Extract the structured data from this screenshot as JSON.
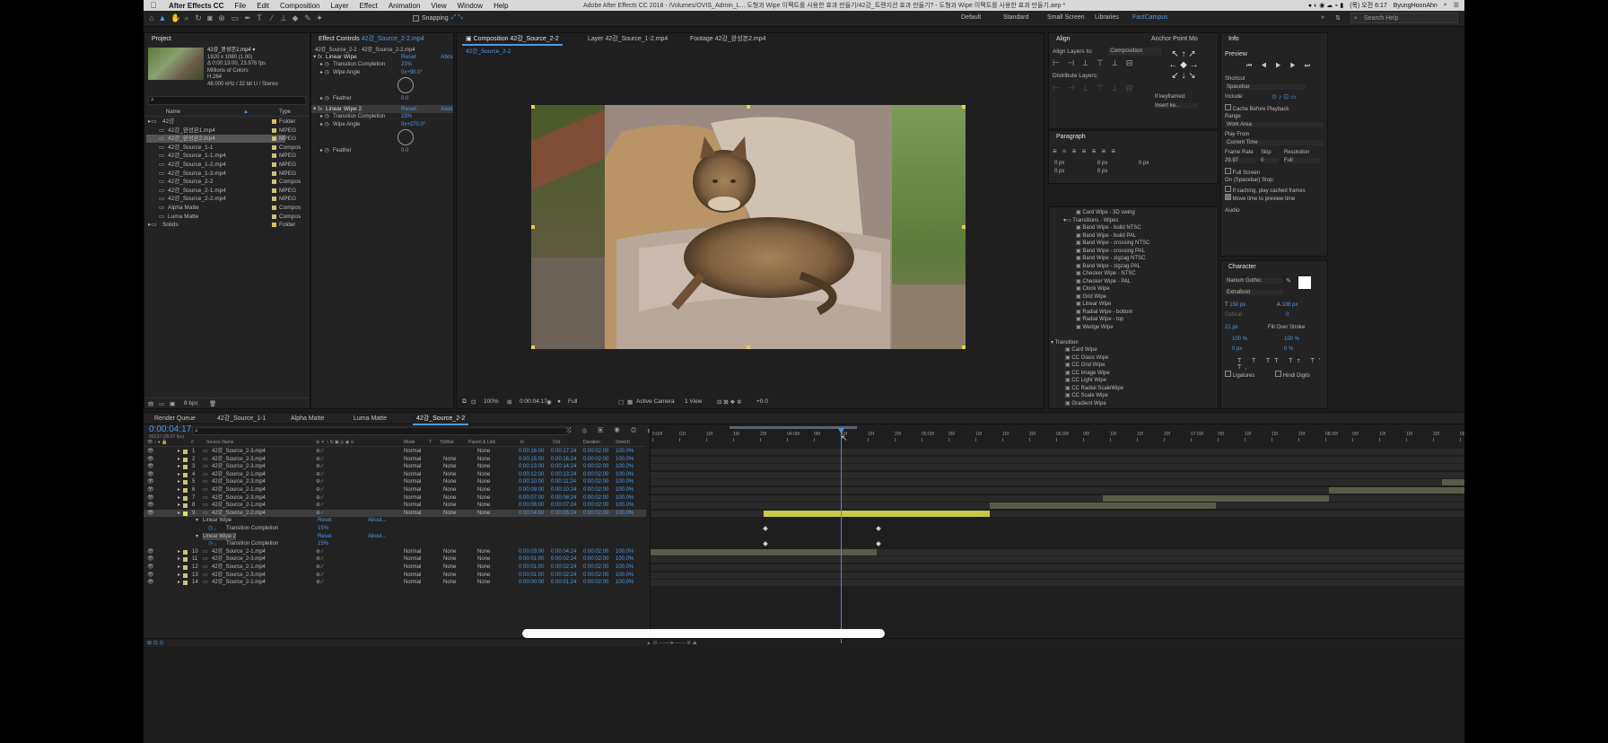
{
  "menubar": {
    "app_name": "After Effects CC",
    "items": [
      "File",
      "Edit",
      "Composition",
      "Layer",
      "Effect",
      "Animation",
      "View",
      "Window",
      "Help"
    ],
    "window_title": "Adobe After Effects CC 2018 - /Volumes/OVIS_Admin_L... 도형과 Wipe 이펙트를 사용한 효과 만들기/42강_트랜지션 효과 만들기? - 도형과 Wipe 이펙트를 사용한 효과 만들기.aep *",
    "clock": "(목) 오전 6:17",
    "user": "ByungHoonAhn"
  },
  "toolbar": {
    "snapping_label": "Snapping",
    "workspaces": [
      "Default",
      "Standard",
      "Small Screen",
      "Libraries",
      "FastCampus"
    ],
    "active_workspace": "FastCampus",
    "search_placeholder": "Search Help"
  },
  "project": {
    "tab": "Project",
    "selected_name": "42강_완성본2.mp4 ▾",
    "info_lines": [
      "1920 x 1080 (1.00)",
      "Δ 0:00:13:00, 23.976 fps",
      "Millions of Colors",
      "H.264",
      "48.000 kHz / 32 bit U / Stereo"
    ],
    "columns": {
      "name": "Name",
      "type": "Type"
    },
    "items": [
      {
        "name": "42강",
        "type": "Folder",
        "color": "#e0c050",
        "folder": true
      },
      {
        "name": "42강_완성본1.mp4",
        "type": "MPEG",
        "color": "#c9c37a"
      },
      {
        "name": "42강_완성본2.mp4",
        "type": "MPEG",
        "color": "#c9c37a",
        "selected": true
      },
      {
        "name": "42강_Source_1-1",
        "type": "Compos",
        "color": "#c9c37a"
      },
      {
        "name": "42강_Source_1-1.mp4",
        "type": "MPEG",
        "color": "#c9c37a"
      },
      {
        "name": "42강_Source_1-2.mp4",
        "type": "MPEG",
        "color": "#c9c37a"
      },
      {
        "name": "42강_Source_1-3.mp4",
        "type": "MPEG",
        "color": "#c9c37a"
      },
      {
        "name": "42강_Source_2-2",
        "type": "Compos",
        "color": "#c9c37a"
      },
      {
        "name": "42강_Source_2-1.mp4",
        "type": "MPEG",
        "color": "#c9c37a"
      },
      {
        "name": "42강_Source_2-2.mp4",
        "type": "MPEG",
        "color": "#c9c37a"
      },
      {
        "name": "Alpha Matte",
        "type": "Compos",
        "color": "#c9c37a"
      },
      {
        "name": "Luma Matte",
        "type": "Compos",
        "color": "#c9c37a"
      },
      {
        "name": "Solids",
        "type": "Folder",
        "color": "#e0c050",
        "folder": true
      }
    ],
    "bpc": "8 bpc"
  },
  "effect_controls": {
    "tab_prefix": "Effect Controls",
    "tab_target": "42강_Source_2-2.mp4",
    "breadcrumb": "42강_Source_2-2 · 42강_Source_2-2.mp4",
    "effects": [
      {
        "name": "Linear Wipe",
        "reset": "Reset",
        "about": "About...",
        "props": [
          {
            "label": "Transition Completion",
            "value": "23%"
          },
          {
            "label": "Wipe Angle",
            "value": "0x+90.0°"
          },
          {
            "label": "Feather",
            "value": "0.0"
          }
        ]
      },
      {
        "name": "Linear Wipe 2",
        "reset": "Reset",
        "about": "About...",
        "props": [
          {
            "label": "Transition Completion",
            "value": "23%"
          },
          {
            "label": "Wipe Angle",
            "value": "0x+270.0°"
          },
          {
            "label": "Feather",
            "value": "0.0"
          }
        ]
      }
    ]
  },
  "viewer": {
    "tabs": [
      {
        "label": "Composition 42강_Source_2-2",
        "active": true
      },
      {
        "label": "Layer 42강_Source_1-2.mp4"
      },
      {
        "label": "Footage 42강_완성본2.mp4"
      }
    ],
    "sub_tab": "42강_Source_2-2",
    "zoom": "100%",
    "timecode": "0:00:04:17",
    "resolution": "Full",
    "camera": "Active Camera",
    "views": "1 View",
    "exposure": "+0.0"
  },
  "align": {
    "title": "Align",
    "align_to_label": "Align Layers to:",
    "align_to_value": "Composition",
    "distribute_label": "Distribute Layers:",
    "anchor_title": "Anchor Point Mo",
    "if_keyframed": "If keyframed:",
    "insert_key": "Insert ke..."
  },
  "paragraph": {
    "title": "Paragraph",
    "values": [
      "0 px",
      "0 px",
      "0 px",
      "0 px",
      "0 px"
    ]
  },
  "effects_presets": {
    "group1": [
      "Card Wipe - 3D swing"
    ],
    "group2_title": "Transitions - Wipes",
    "group2": [
      "Band Wipe - build NTSC",
      "Band Wipe - build PAL",
      "Band Wipe - crossing NTSC",
      "Band Wipe - crossing PAL",
      "Band Wipe - zigzag NTSC",
      "Band Wipe - zigzag PAL",
      "Checker Wipe - NTSC",
      "Checker Wipe - PAL",
      "Clock Wipe",
      "Grid Wipe",
      "Linear Wipe",
      "Radial Wipe - bottom",
      "Radial Wipe - top",
      "Wedge Wipe"
    ],
    "group3_title": "Transition",
    "group3": [
      "Card Wipe",
      "CC Glass Wipe",
      "CC Grid Wipe",
      "CC Image Wipe",
      "CC Light Wipe",
      "CC Radial ScaleWipe",
      "CC Scale Wipe",
      "Gradient Wipe",
      "Iris Wipe",
      "Linear Wipe",
      "Radial Wipe"
    ],
    "highlighted": "Linear Wipe"
  },
  "info": {
    "tab": "Info",
    "preview_title": "Preview",
    "shortcut_label": "Shortcut",
    "shortcut_value": "Spacebar",
    "include_label": "Include:",
    "cache_label": "Cache Before Playback",
    "range_label": "Range",
    "range_value": "Work Area",
    "play_from_label": "Play From",
    "play_from_value": "Current Time",
    "frame_rate_label": "Frame Rate",
    "skip_label": "Skip",
    "resolution_label": "Resolution",
    "frame_rate_value": "29.97",
    "skip_value": "0",
    "resolution_value": "Full",
    "full_screen": "Full Screen",
    "on_stop": "On (Spacebar) Stop:",
    "if_caching": "If caching, play cached frames",
    "move_time": "Move time to preview time",
    "audio": "Audio"
  },
  "character": {
    "title": "Character",
    "font": "Nanum Gothic",
    "style": "ExtraBold",
    "size": "150 px",
    "leading": "108 px",
    "kerning": "Optical",
    "tracking": "0",
    "stroke": "21 px",
    "stroke_type": "Fill Over Stroke",
    "vscale": "100 %",
    "hscale": "100 %",
    "baseline": "0 px",
    "tsume": "0 %",
    "ligatures": "Ligatures",
    "hindi": "Hindi Digits"
  },
  "timeline": {
    "tabs": [
      "Render Queue",
      "42강_Source_1-1",
      "Alpha Matte",
      "Luma Matte",
      "42강_Source_2-2"
    ],
    "active_tab": "42강_Source_2-2",
    "timecode": "0:00:04:17",
    "frames": "00137 (29.97 fps)",
    "columns": [
      "#",
      "Source Name",
      "Mode",
      "T",
      "TrkMat",
      "Parent & Link",
      "In",
      "Out",
      "Duration",
      "Stretch"
    ],
    "ruler": [
      "0:00f",
      "01f",
      "10f",
      "15f",
      "20f",
      "04:00f",
      "05f",
      "10f",
      "15f",
      "20f",
      "05:00f",
      "05f",
      "10f",
      "15f",
      "20f",
      "06:00f",
      "05f",
      "10f",
      "15f",
      "20f",
      "07:00f",
      "05f",
      "10f",
      "15f",
      "20f",
      "08:00f",
      "05f",
      "10f",
      "15f",
      "20f",
      "09:0"
    ],
    "layers": [
      {
        "num": "1",
        "name": "42강_Source_2-3.mp4",
        "mode": "Normal",
        "trk": "",
        "parent": "None",
        "in": "0:00:16:00",
        "out": "0:00:17:24",
        "dur": "0:00:02:00",
        "stretch": "100.0%",
        "color": "#c9c37a"
      },
      {
        "num": "2",
        "name": "42강_Source_2-3.mp4",
        "mode": "Normal",
        "trk": "None",
        "parent": "None",
        "in": "0:00:15:00",
        "out": "0:00:16:24",
        "dur": "0:00:02:00",
        "stretch": "100.0%",
        "color": "#c9c37a"
      },
      {
        "num": "3",
        "name": "42강_Source_2-3.mp4",
        "mode": "Normal",
        "trk": "None",
        "parent": "None",
        "in": "0:00:13:00",
        "out": "0:00:14:24",
        "dur": "0:00:02:00",
        "stretch": "100.0%",
        "color": "#c9c37a"
      },
      {
        "num": "4",
        "name": "42강_Source_2-1.mp4",
        "mode": "Normal",
        "trk": "None",
        "parent": "None",
        "in": "0:00:12:00",
        "out": "0:00:13:24",
        "dur": "0:00:02:00",
        "stretch": "100.0%",
        "color": "#c9c37a"
      },
      {
        "num": "5",
        "name": "42강_Source_2-3.mp4",
        "mode": "Normal",
        "trk": "None",
        "parent": "None",
        "in": "0:00:10:00",
        "out": "0:00:11:24",
        "dur": "0:00:02:00",
        "stretch": "100.0%",
        "color": "#c9c37a"
      },
      {
        "num": "6",
        "name": "42강_Source_2-1.mp4",
        "mode": "Normal",
        "trk": "None",
        "parent": "None",
        "in": "0:00:09:00",
        "out": "0:00:10:24",
        "dur": "0:00:02:00",
        "stretch": "100.0%",
        "color": "#c9c37a"
      },
      {
        "num": "7",
        "name": "42강_Source_2-3.mp4",
        "mode": "Normal",
        "trk": "None",
        "parent": "None",
        "in": "0:00:07:00",
        "out": "0:00:08:24",
        "dur": "0:00:02:00",
        "stretch": "100.0%",
        "color": "#c9c37a"
      },
      {
        "num": "8",
        "name": "42강_Source_2-1.mp4",
        "mode": "Normal",
        "trk": "None",
        "parent": "None",
        "in": "0:00:06:00",
        "out": "0:00:07:24",
        "dur": "0:00:02:00",
        "stretch": "100.0%",
        "color": "#c9c37a"
      },
      {
        "num": "9",
        "name": "42강_Source_2-2.mp4",
        "mode": "Normal",
        "trk": "None",
        "parent": "None",
        "in": "0:00:04:00",
        "out": "0:00:05:24",
        "dur": "0:00:02:00",
        "stretch": "100.0%",
        "color": "#e0e060",
        "selected": true
      },
      {
        "num": "10",
        "name": "42강_Source_2-1.mp4",
        "mode": "Normal",
        "trk": "None",
        "parent": "None",
        "in": "0:00:03:00",
        "out": "0:00:04:24",
        "dur": "0:00:02:00",
        "stretch": "100.0%",
        "color": "#c9c37a"
      },
      {
        "num": "11",
        "name": "42강_Source_2-3.mp4",
        "mode": "Normal",
        "trk": "None",
        "parent": "None",
        "in": "0:00:01:00",
        "out": "0:00:02:24",
        "dur": "0:00:02:00",
        "stretch": "100.0%",
        "color": "#c9c37a"
      },
      {
        "num": "12",
        "name": "42강_Source_2-1.mp4",
        "mode": "Normal",
        "trk": "None",
        "parent": "None",
        "in": "0:00:01:00",
        "out": "0:00:02:24",
        "dur": "0:00:02:00",
        "stretch": "100.0%",
        "color": "#c9c37a"
      },
      {
        "num": "13",
        "name": "42강_Source_2-3.mp4",
        "mode": "Normal",
        "trk": "None",
        "parent": "None",
        "in": "0:00:01:00",
        "out": "0:00:02:24",
        "dur": "0:00:02:00",
        "stretch": "100.0%",
        "color": "#c9c37a"
      },
      {
        "num": "14",
        "name": "42강_Source_2-1.mp4",
        "mode": "Normal",
        "trk": "None",
        "parent": "None",
        "in": "0:00:00:00",
        "out": "0:00:01:24",
        "dur": "0:00:02:00",
        "stretch": "100.0%",
        "color": "#c9c37a"
      }
    ],
    "fx_rows": [
      {
        "label": "Linear Wipe",
        "reset": "Reset",
        "about": "About..."
      },
      {
        "label": "Transition Completion",
        "value": "15%"
      },
      {
        "label": "Linear Wipe 2",
        "reset": "Reset",
        "about": "About..."
      },
      {
        "label": "Transition Completion",
        "value": "15%"
      }
    ],
    "toggle": "Toggle Switches / Modes"
  },
  "colors": {
    "accent": "#4f9ae6",
    "panel": "#232323",
    "layer_bar": "#c8c84a",
    "playhead": "#4f8ad8"
  }
}
